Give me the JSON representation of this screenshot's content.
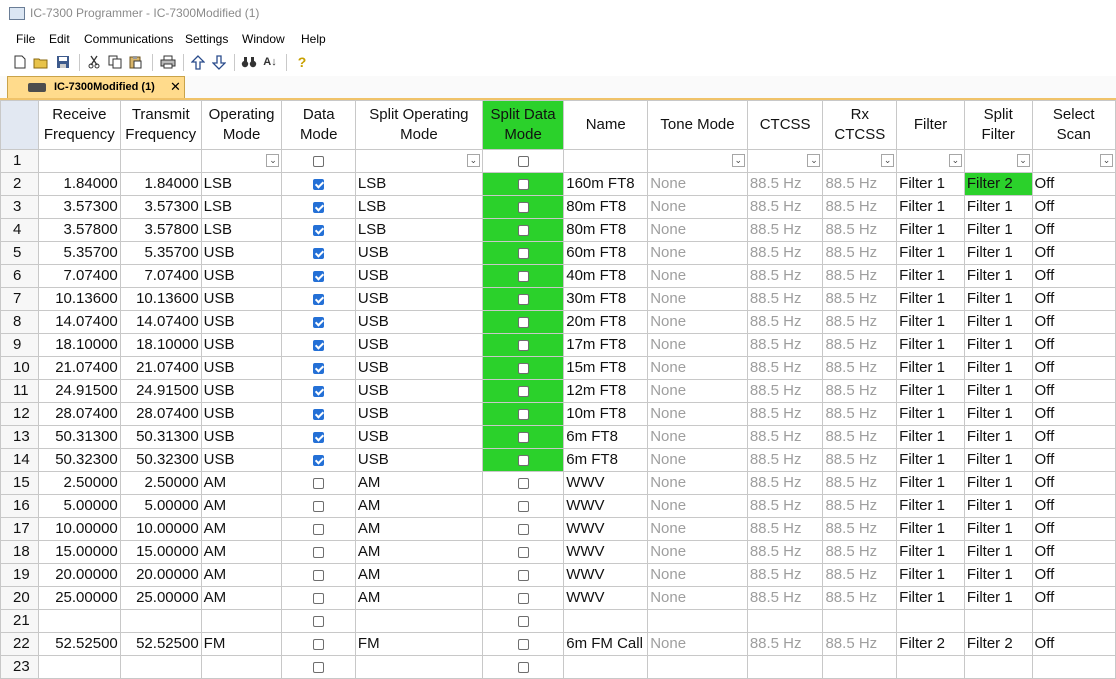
{
  "window": {
    "title": "IC-7300 Programmer - IC-7300Modified (1)"
  },
  "menu": [
    "File",
    "Edit",
    "Communications",
    "Settings",
    "Window",
    "Help"
  ],
  "toolbar": {
    "icons": [
      "new-file-icon",
      "open-folder-icon",
      "save-icon",
      "cut-icon",
      "copy-icon",
      "paste-icon",
      "print-icon",
      "upload-icon",
      "download-icon",
      "find-icon",
      "sort-icon",
      "help-icon"
    ]
  },
  "tab": {
    "label": "IC-7300Modified (1)",
    "close": "✕"
  },
  "columns": [
    "Receive Frequency",
    "Transmit Frequency",
    "Operating Mode",
    "Data Mode",
    "Split Operating Mode",
    "Split Data Mode",
    "Name",
    "Tone Mode",
    "CTCSS",
    "Rx CTCSS",
    "Filter",
    "Split Filter",
    "Select Scan"
  ],
  "rows": [
    {
      "n": "1",
      "rx": "",
      "tx": "",
      "mode": "",
      "data": false,
      "smode": "",
      "sdata": false,
      "name": "",
      "tone": "",
      "ctcss": "",
      "rxctcss": "",
      "filter": "",
      "sfilter": "",
      "scan": ""
    },
    {
      "n": "2",
      "rx": "1.84000",
      "tx": "1.84000",
      "mode": "LSB",
      "data": true,
      "smode": "LSB",
      "sdata": false,
      "name": "160m FT8",
      "tone": "None",
      "ctcss": "88.5 Hz",
      "rxctcss": "88.5 Hz",
      "filter": "Filter 1",
      "sfilter": "Filter 2",
      "scan": "Off"
    },
    {
      "n": "3",
      "rx": "3.57300",
      "tx": "3.57300",
      "mode": "LSB",
      "data": true,
      "smode": "LSB",
      "sdata": false,
      "name": "80m FT8",
      "tone": "None",
      "ctcss": "88.5 Hz",
      "rxctcss": "88.5 Hz",
      "filter": "Filter 1",
      "sfilter": "Filter 1",
      "scan": "Off"
    },
    {
      "n": "4",
      "rx": "3.57800",
      "tx": "3.57800",
      "mode": "LSB",
      "data": true,
      "smode": "LSB",
      "sdata": false,
      "name": "80m FT8",
      "tone": "None",
      "ctcss": "88.5 Hz",
      "rxctcss": "88.5 Hz",
      "filter": "Filter 1",
      "sfilter": "Filter 1",
      "scan": "Off"
    },
    {
      "n": "5",
      "rx": "5.35700",
      "tx": "5.35700",
      "mode": "USB",
      "data": true,
      "smode": "USB",
      "sdata": false,
      "name": "60m FT8",
      "tone": "None",
      "ctcss": "88.5 Hz",
      "rxctcss": "88.5 Hz",
      "filter": "Filter 1",
      "sfilter": "Filter 1",
      "scan": "Off"
    },
    {
      "n": "6",
      "rx": "7.07400",
      "tx": "7.07400",
      "mode": "USB",
      "data": true,
      "smode": "USB",
      "sdata": false,
      "name": "40m FT8",
      "tone": "None",
      "ctcss": "88.5 Hz",
      "rxctcss": "88.5 Hz",
      "filter": "Filter 1",
      "sfilter": "Filter 1",
      "scan": "Off"
    },
    {
      "n": "7",
      "rx": "10.13600",
      "tx": "10.13600",
      "mode": "USB",
      "data": true,
      "smode": "USB",
      "sdata": false,
      "name": "30m FT8",
      "tone": "None",
      "ctcss": "88.5 Hz",
      "rxctcss": "88.5 Hz",
      "filter": "Filter 1",
      "sfilter": "Filter 1",
      "scan": "Off"
    },
    {
      "n": "8",
      "rx": "14.07400",
      "tx": "14.07400",
      "mode": "USB",
      "data": true,
      "smode": "USB",
      "sdata": false,
      "name": "20m FT8",
      "tone": "None",
      "ctcss": "88.5 Hz",
      "rxctcss": "88.5 Hz",
      "filter": "Filter 1",
      "sfilter": "Filter 1",
      "scan": "Off"
    },
    {
      "n": "9",
      "rx": "18.10000",
      "tx": "18.10000",
      "mode": "USB",
      "data": true,
      "smode": "USB",
      "sdata": false,
      "name": "17m FT8",
      "tone": "None",
      "ctcss": "88.5 Hz",
      "rxctcss": "88.5 Hz",
      "filter": "Filter 1",
      "sfilter": "Filter 1",
      "scan": "Off"
    },
    {
      "n": "10",
      "rx": "21.07400",
      "tx": "21.07400",
      "mode": "USB",
      "data": true,
      "smode": "USB",
      "sdata": false,
      "name": "15m FT8",
      "tone": "None",
      "ctcss": "88.5 Hz",
      "rxctcss": "88.5 Hz",
      "filter": "Filter 1",
      "sfilter": "Filter 1",
      "scan": "Off"
    },
    {
      "n": "11",
      "rx": "24.91500",
      "tx": "24.91500",
      "mode": "USB",
      "data": true,
      "smode": "USB",
      "sdata": false,
      "name": "12m FT8",
      "tone": "None",
      "ctcss": "88.5 Hz",
      "rxctcss": "88.5 Hz",
      "filter": "Filter 1",
      "sfilter": "Filter 1",
      "scan": "Off"
    },
    {
      "n": "12",
      "rx": "28.07400",
      "tx": "28.07400",
      "mode": "USB",
      "data": true,
      "smode": "USB",
      "sdata": false,
      "name": "10m FT8",
      "tone": "None",
      "ctcss": "88.5 Hz",
      "rxctcss": "88.5 Hz",
      "filter": "Filter 1",
      "sfilter": "Filter 1",
      "scan": "Off"
    },
    {
      "n": "13",
      "rx": "50.31300",
      "tx": "50.31300",
      "mode": "USB",
      "data": true,
      "smode": "USB",
      "sdata": false,
      "name": "6m FT8",
      "tone": "None",
      "ctcss": "88.5 Hz",
      "rxctcss": "88.5 Hz",
      "filter": "Filter 1",
      "sfilter": "Filter 1",
      "scan": "Off"
    },
    {
      "n": "14",
      "rx": "50.32300",
      "tx": "50.32300",
      "mode": "USB",
      "data": true,
      "smode": "USB",
      "sdata": false,
      "name": "6m FT8",
      "tone": "None",
      "ctcss": "88.5 Hz",
      "rxctcss": "88.5 Hz",
      "filter": "Filter 1",
      "sfilter": "Filter 1",
      "scan": "Off"
    },
    {
      "n": "15",
      "rx": "2.50000",
      "tx": "2.50000",
      "mode": "AM",
      "data": false,
      "smode": "AM",
      "sdata": false,
      "name": "WWV",
      "tone": "None",
      "ctcss": "88.5 Hz",
      "rxctcss": "88.5 Hz",
      "filter": "Filter 1",
      "sfilter": "Filter 1",
      "scan": "Off"
    },
    {
      "n": "16",
      "rx": "5.00000",
      "tx": "5.00000",
      "mode": "AM",
      "data": false,
      "smode": "AM",
      "sdata": false,
      "name": "WWV",
      "tone": "None",
      "ctcss": "88.5 Hz",
      "rxctcss": "88.5 Hz",
      "filter": "Filter 1",
      "sfilter": "Filter 1",
      "scan": "Off"
    },
    {
      "n": "17",
      "rx": "10.00000",
      "tx": "10.00000",
      "mode": "AM",
      "data": false,
      "smode": "AM",
      "sdata": false,
      "name": "WWV",
      "tone": "None",
      "ctcss": "88.5 Hz",
      "rxctcss": "88.5 Hz",
      "filter": "Filter 1",
      "sfilter": "Filter 1",
      "scan": "Off"
    },
    {
      "n": "18",
      "rx": "15.00000",
      "tx": "15.00000",
      "mode": "AM",
      "data": false,
      "smode": "AM",
      "sdata": false,
      "name": "WWV",
      "tone": "None",
      "ctcss": "88.5 Hz",
      "rxctcss": "88.5 Hz",
      "filter": "Filter 1",
      "sfilter": "Filter 1",
      "scan": "Off"
    },
    {
      "n": "19",
      "rx": "20.00000",
      "tx": "20.00000",
      "mode": "AM",
      "data": false,
      "smode": "AM",
      "sdata": false,
      "name": "WWV",
      "tone": "None",
      "ctcss": "88.5 Hz",
      "rxctcss": "88.5 Hz",
      "filter": "Filter 1",
      "sfilter": "Filter 1",
      "scan": "Off"
    },
    {
      "n": "20",
      "rx": "25.00000",
      "tx": "25.00000",
      "mode": "AM",
      "data": false,
      "smode": "AM",
      "sdata": false,
      "name": "WWV",
      "tone": "None",
      "ctcss": "88.5 Hz",
      "rxctcss": "88.5 Hz",
      "filter": "Filter 1",
      "sfilter": "Filter 1",
      "scan": "Off"
    },
    {
      "n": "21",
      "rx": "",
      "tx": "",
      "mode": "",
      "data": false,
      "smode": "",
      "sdata": false,
      "name": "",
      "tone": "",
      "ctcss": "",
      "rxctcss": "",
      "filter": "",
      "sfilter": "",
      "scan": ""
    },
    {
      "n": "22",
      "rx": "52.52500",
      "tx": "52.52500",
      "mode": "FM",
      "data": false,
      "smode": "FM",
      "sdata": false,
      "name": "6m FM Call",
      "tone": "None",
      "ctcss": "88.5 Hz",
      "rxctcss": "88.5 Hz",
      "filter": "Filter 2",
      "sfilter": "Filter 2",
      "scan": "Off"
    },
    {
      "n": "23",
      "rx": "",
      "tx": "",
      "mode": "",
      "data": false,
      "smode": "",
      "sdata": false,
      "name": "",
      "tone": "",
      "ctcss": "",
      "rxctcss": "",
      "filter": "",
      "sfilter": "",
      "scan": ""
    }
  ],
  "highlights": {
    "color": "#2bd12b",
    "column": "Split Data Mode",
    "split_data_mode_rows": [
      "2",
      "3",
      "4",
      "5",
      "6",
      "7",
      "8",
      "9",
      "10",
      "11",
      "12",
      "13",
      "14"
    ],
    "split_filter_row": "2"
  },
  "colors": {
    "checked": "#2470d6",
    "tab": "#ffdb8c",
    "gray_text": "#9e9e9e"
  }
}
